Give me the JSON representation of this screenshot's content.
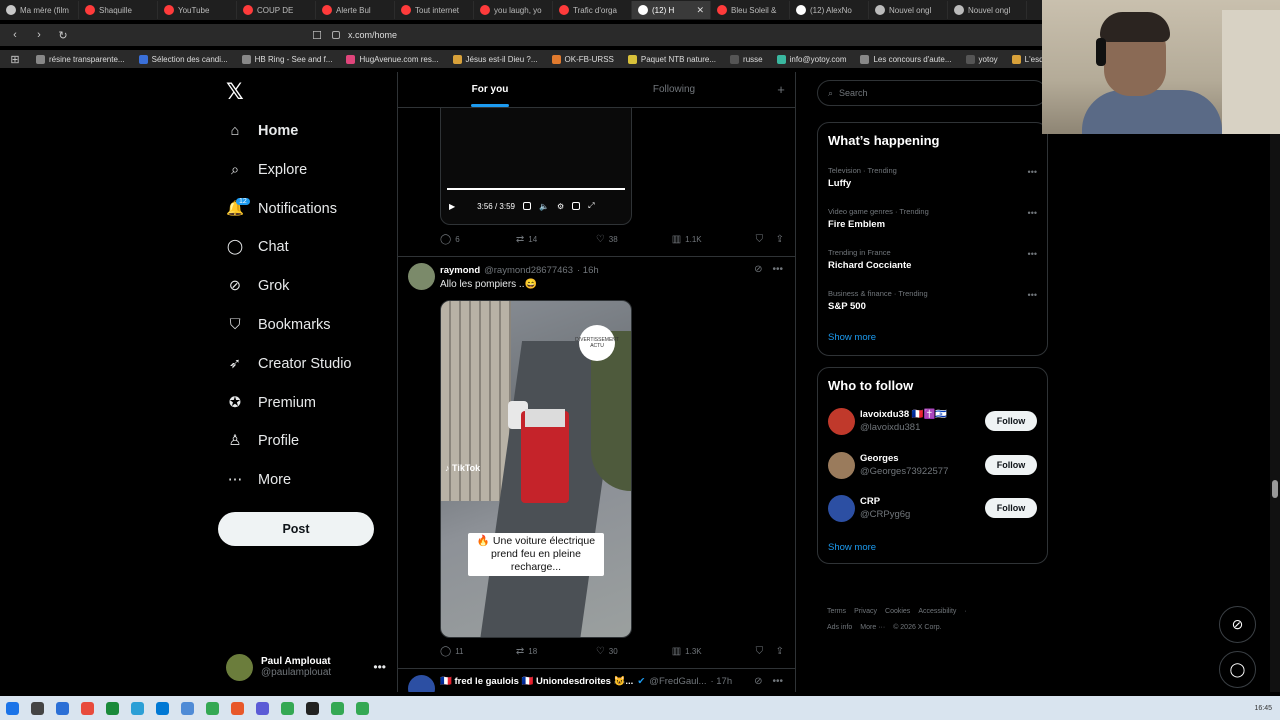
{
  "browser": {
    "tabs": [
      {
        "label": "Ma mère (film",
        "color": "#c7c7c7",
        "active": false
      },
      {
        "label": "Shaquille",
        "color": "#ff3b3b",
        "active": false
      },
      {
        "label": "YouTube",
        "color": "#ff3b3b",
        "active": false
      },
      {
        "label": "COUP DE",
        "color": "#ff3b3b",
        "active": false
      },
      {
        "label": "Alerte Bul",
        "color": "#ff3b3b",
        "active": false
      },
      {
        "label": "Tout internet",
        "color": "#ff3b3b",
        "active": false
      },
      {
        "label": "you laugh, yo",
        "color": "#ff3b3b",
        "active": false
      },
      {
        "label": "Trafic d'orga",
        "color": "#ff3b3b",
        "active": false
      },
      {
        "label": "(12) H",
        "color": "#ffffff",
        "active": true
      },
      {
        "label": "Bleu Soleil &",
        "color": "#ff3b3b",
        "active": false
      },
      {
        "label": "(12) AlexNo",
        "color": "#ffffff",
        "active": false
      },
      {
        "label": "Nouvel ongl",
        "color": "#bbbbbb",
        "active": false
      },
      {
        "label": "Nouvel ongl",
        "color": "#bbbbbb",
        "active": false
      }
    ],
    "active_tab_close": "✕",
    "url": "x.com/home",
    "bookmarks": [
      {
        "label": "résine transparente...",
        "color": "#888"
      },
      {
        "label": "Sélection des candi...",
        "color": "#3a6fd8"
      },
      {
        "label": "HB Ring - See and f...",
        "color": "#888"
      },
      {
        "label": "HugAvenue.com res...",
        "color": "#e0457b"
      },
      {
        "label": "Jésus est-il Dieu ?...",
        "color": "#d8a13a"
      },
      {
        "label": "OK-FB-URSS",
        "color": "#e07a2e"
      },
      {
        "label": "Paquet NTB nature...",
        "color": "#d8c13a"
      },
      {
        "label": "russe",
        "color": "#555"
      },
      {
        "label": "info@yotoy.com",
        "color": "#3ab8a0"
      },
      {
        "label": "Les concours d'aute...",
        "color": "#888"
      },
      {
        "label": "yotoy",
        "color": "#555"
      },
      {
        "label": "L'esqu",
        "color": "#d8a13a"
      }
    ]
  },
  "nav": {
    "logo": "𝕏",
    "items": [
      {
        "label": "Home",
        "icon": "home-icon",
        "glyph": "⌂"
      },
      {
        "label": "Explore",
        "icon": "search-icon",
        "glyph": "⌕"
      },
      {
        "label": "Notifications",
        "icon": "bell-icon",
        "glyph": "🔔",
        "badge": "12"
      },
      {
        "label": "Chat",
        "icon": "chat-icon",
        "glyph": "◯"
      },
      {
        "label": "Grok",
        "icon": "grok-icon",
        "glyph": "⊘"
      },
      {
        "label": "Bookmarks",
        "icon": "bookmark-icon",
        "glyph": "⛉"
      },
      {
        "label": "Creator Studio",
        "icon": "rocket-icon",
        "glyph": "➶"
      },
      {
        "label": "Premium",
        "icon": "verified-icon",
        "glyph": "✪"
      },
      {
        "label": "Profile",
        "icon": "profile-icon",
        "glyph": "♙"
      },
      {
        "label": "More",
        "icon": "more-icon",
        "glyph": "⋯"
      }
    ],
    "post_label": "Post",
    "account": {
      "name": "Paul Amplouat",
      "handle": "@paulamplouat",
      "more": "•••"
    }
  },
  "feed": {
    "tabs": [
      "For you",
      "Following"
    ],
    "plus": "+",
    "tweet1": {
      "video_time": "3:56 / 3:59",
      "replies": "6",
      "reposts": "14",
      "likes": "38",
      "views": "1.1K"
    },
    "tweet2": {
      "name": "raymond",
      "handle": "@raymond28677463",
      "time": "· 16h",
      "text": "Allo les pompiers ..😄",
      "badge_text": "DIVERTISSEMENT ACTU",
      "tiktok_text": "♪ TikTok",
      "caption": "🔥 Une voiture électrique prend feu en pleine recharge...",
      "replies": "11",
      "reposts": "18",
      "likes": "30",
      "views": "1.3K"
    },
    "tweet3": {
      "name": "🇫🇷 fred le gaulois 🇫🇷 Uniondesdroites 😺...",
      "handle": "@FredGaul...",
      "time": "· 17h"
    }
  },
  "sidebar": {
    "search_placeholder": "Search",
    "trends_title": "What’s happening",
    "trends": [
      {
        "category": "Television · Trending",
        "name": "Luffy"
      },
      {
        "category": "Video game genres · Trending",
        "name": "Fire Emblem"
      },
      {
        "category": "Trending in France",
        "name": "Richard Cocciante"
      },
      {
        "category": "Business & finance · Trending",
        "name": "S&P 500"
      }
    ],
    "trend_more": "•••",
    "show_more": "Show more",
    "wtf_title": "Who to follow",
    "follow_label": "Follow",
    "who_to_follow": [
      {
        "name": "lavoixdu38 🇫🇷✝️🇮🇱",
        "handle": "@lavoixdu381",
        "color": "#c0392b"
      },
      {
        "name": "Georges",
        "handle": "@Georges73922577",
        "color": "#9a7b5c"
      },
      {
        "name": "CRP",
        "handle": "@CRPyg6g",
        "color": "#2c4fa3"
      }
    ],
    "wtf_show_more": "Show more",
    "footer_line1": [
      "Terms",
      "Privacy",
      "Cookies",
      "Accessibility",
      "·"
    ],
    "footer_line2": [
      "Ads info",
      "More ···",
      "© 2026 X Corp."
    ]
  },
  "taskbar": {
    "clock": "16:45"
  }
}
